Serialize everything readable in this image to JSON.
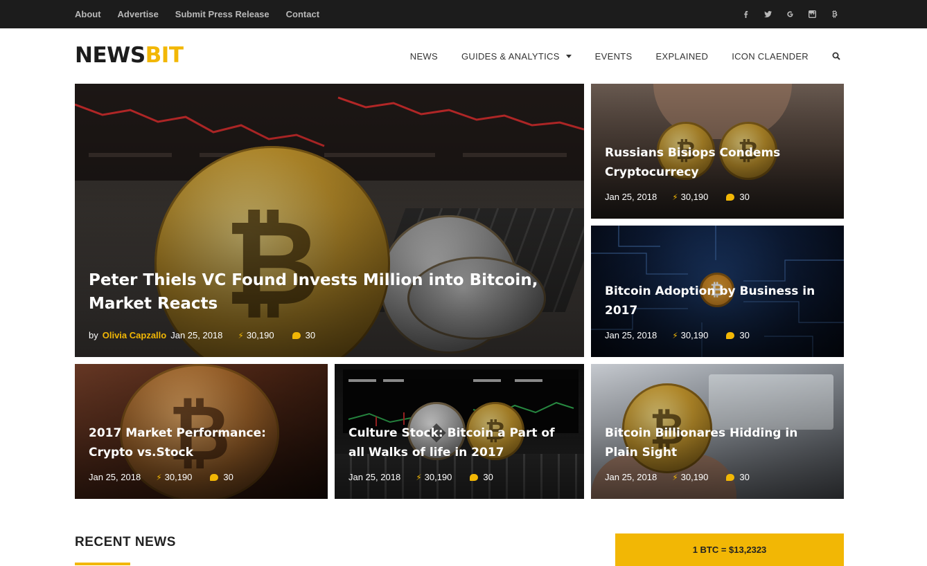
{
  "topbar": {
    "links": [
      "About",
      "Advertise",
      "Submit Press Release",
      "Contact"
    ],
    "social_icons": [
      "facebook-icon",
      "twitter-icon",
      "google-plus-icon",
      "instagram-icon",
      "bitcoin-icon"
    ]
  },
  "header": {
    "logo_part1": "NEWS",
    "logo_part2": "BIT",
    "nav": [
      "NEWS",
      "GUIDES & ANALYTICS",
      "EVENTS",
      "EXPLAINED",
      "ICON CLAENDER"
    ]
  },
  "featured": {
    "title": "Peter Thiels VC Found Invests Million into Bitcoin, Market Reacts",
    "by": "by",
    "author": "Olivia Capzallo",
    "date": "Jan 25, 2018",
    "views": "30,190",
    "comments": "30"
  },
  "cards": [
    {
      "title": "Russians Bisiops Condems Cryptocurrecy",
      "date": "Jan 25, 2018",
      "views": "30,190",
      "comments": "30"
    },
    {
      "title": "Bitcoin Adoption by Business in 2017",
      "date": "Jan 25, 2018",
      "views": "30,190",
      "comments": "30"
    },
    {
      "title": "2017 Market Performance: Crypto vs.Stock",
      "date": "Jan 25, 2018",
      "views": "30,190",
      "comments": "30"
    },
    {
      "title": "Culture Stock: Bitcoin a Part of all Walks of life in 2017",
      "date": "Jan 25, 2018",
      "views": "30,190",
      "comments": "30"
    },
    {
      "title": "Bitcoin Billionares Hidding in Plain Sight",
      "date": "Jan 25, 2018",
      "views": "30,190",
      "comments": "30"
    }
  ],
  "recent_heading": "RECENT NEWS",
  "btc_price": "1 BTC = $13,2323",
  "colors": {
    "accent": "#f2b705",
    "topbar": "#1c1c1c"
  }
}
